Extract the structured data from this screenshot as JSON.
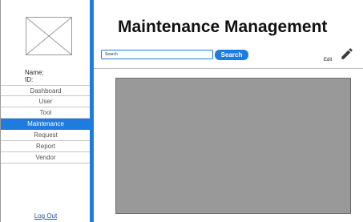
{
  "profile": {
    "name_label": "Name:",
    "id_label": "ID:"
  },
  "sidebar": {
    "items": [
      {
        "label": "Dashboard",
        "active": false
      },
      {
        "label": "User",
        "active": false
      },
      {
        "label": "Tool",
        "active": false
      },
      {
        "label": "Maintenance",
        "active": true
      },
      {
        "label": "Request",
        "active": false
      },
      {
        "label": "Report",
        "active": false
      },
      {
        "label": "Vendor",
        "active": false
      }
    ],
    "logout_label": "Log Out"
  },
  "header": {
    "title": "Maintenance Management"
  },
  "search": {
    "value": "Search",
    "button_label": "Search"
  },
  "toolbar": {
    "edit_label": "Edit",
    "edit_icon": "pencil-icon"
  },
  "colors": {
    "accent": "#1e7be0",
    "content_placeholder": "#999999"
  }
}
